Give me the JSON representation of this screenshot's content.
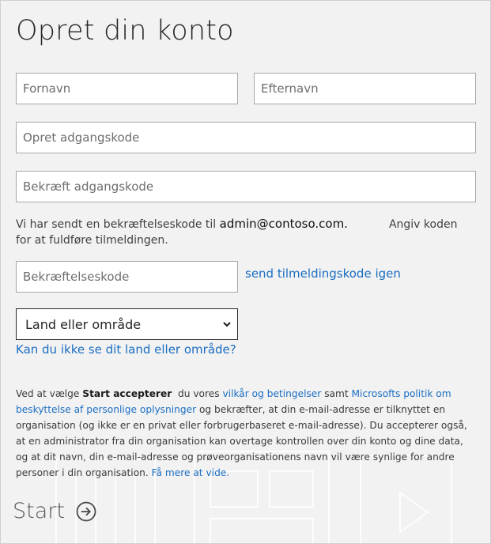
{
  "title": "Opret din konto",
  "fields": {
    "first_name": {
      "placeholder": "Fornavn",
      "value": ""
    },
    "last_name": {
      "placeholder": "Efternavn",
      "value": ""
    },
    "password": {
      "placeholder": "Opret adgangskode",
      "value": ""
    },
    "confirm_password": {
      "placeholder": "Bekræft adgangskode",
      "value": ""
    },
    "verification_code": {
      "placeholder": "Bekræftelseskode",
      "value": ""
    }
  },
  "info": {
    "sent_prefix": "Vi har sendt en bekræftelseskode til",
    "email": "admin@contoso.com.",
    "enter_code": "Angiv koden",
    "suffix": "for at fuldføre tilmeldingen."
  },
  "resend_link": "send tilmeldingskode igen",
  "country_select": {
    "selected": "Land eller område"
  },
  "cant_see_link": "Kan du ikke se dit land eller område?",
  "legal": {
    "p1": "Ved at vælge ",
    "start_bold": "Start accepterer",
    "p2": "  du vores ",
    "terms_link": "vilkår og betingelser",
    "p3": " samt ",
    "privacy_link": "Microsofts politik om beskyttelse af personlige oplysninger",
    "p4": " og bekræfter, at din e-mail-adresse er tilknyttet en organisation (og ikke er en privat eller forbrugerbaseret e-mail-adresse). Du accepterer også, at en administrator fra din organisation kan overtage kontrollen over din konto og dine data, og at dit navn, din e-mail-adresse og prøveorganisationens navn vil være synlige for andre personer i din organisation. ",
    "learn_more_link": "Få mere at vide."
  },
  "start_button": {
    "label": "Start",
    "icon": "arrow-right-circle-icon"
  },
  "colors": {
    "background": "#f2f2f2",
    "link": "#1b6ec2",
    "field_border": "#a8a8a8"
  }
}
